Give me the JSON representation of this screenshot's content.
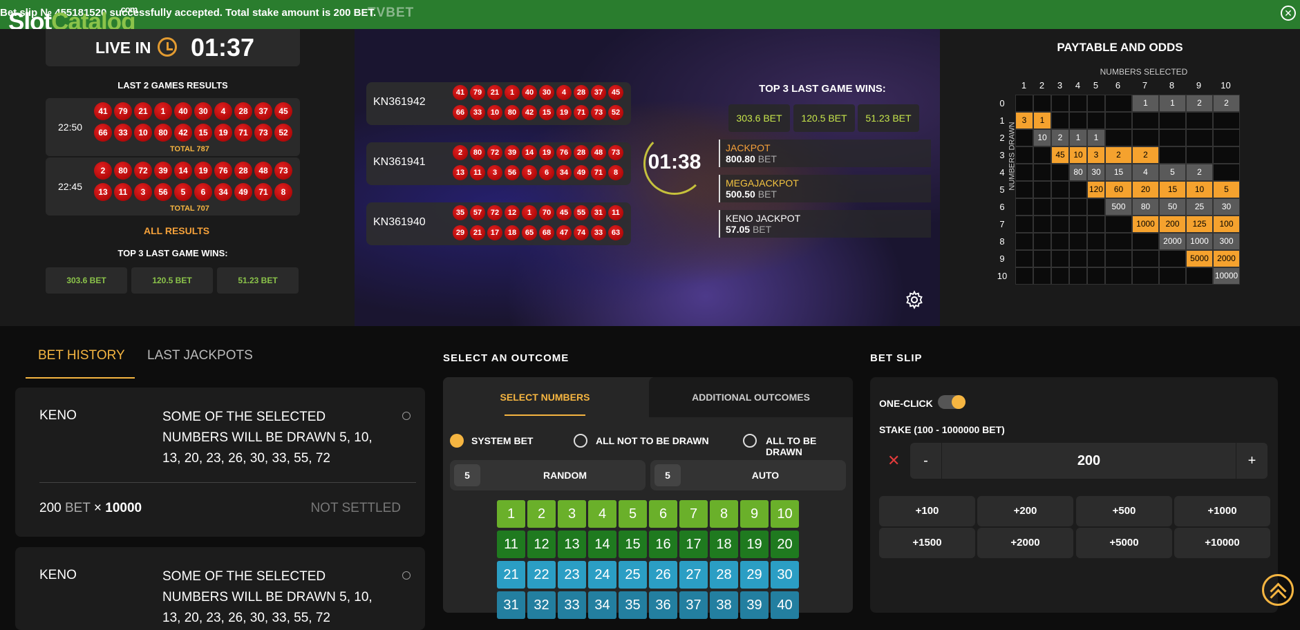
{
  "notification": {
    "message": "Bet slip № 455181520 successfully accepted. Total stake amount is 200 BET.",
    "brand": "TVBET",
    "close_icon": "close-icon"
  },
  "logo": {
    "part1": "Slot",
    "part2": "Catalog",
    "domain": ".com"
  },
  "live": {
    "label": "LIVE IN",
    "time": "01:37"
  },
  "last_games": {
    "title": "LAST 2 GAMES RESULTS",
    "games": [
      {
        "time": "22:50",
        "row1": [
          "41",
          "79",
          "21",
          "1",
          "40",
          "30",
          "4",
          "28",
          "37",
          "45"
        ],
        "row2": [
          "66",
          "33",
          "10",
          "80",
          "42",
          "15",
          "19",
          "71",
          "73",
          "52"
        ],
        "total": "TOTAL 787"
      },
      {
        "time": "22:45",
        "row1": [
          "2",
          "80",
          "72",
          "39",
          "14",
          "19",
          "76",
          "28",
          "48",
          "73"
        ],
        "row2": [
          "13",
          "11",
          "3",
          "56",
          "5",
          "6",
          "34",
          "49",
          "71",
          "8"
        ],
        "total": "TOTAL 707"
      }
    ],
    "all_results": "ALL RESULTS",
    "top3_title": "TOP 3 LAST GAME WINS:",
    "top3": [
      "303.6 BET",
      "120.5 BET",
      "51.23 BET"
    ]
  },
  "video": {
    "rows": [
      {
        "code": "KN361942",
        "row1": [
          "41",
          "79",
          "21",
          "1",
          "40",
          "30",
          "4",
          "28",
          "37",
          "45"
        ],
        "row2": [
          "66",
          "33",
          "10",
          "80",
          "42",
          "15",
          "19",
          "71",
          "73",
          "52"
        ]
      },
      {
        "code": "KN361941",
        "row1": [
          "2",
          "80",
          "72",
          "39",
          "14",
          "19",
          "76",
          "28",
          "48",
          "73"
        ],
        "row2": [
          "13",
          "11",
          "3",
          "56",
          "5",
          "6",
          "34",
          "49",
          "71",
          "8"
        ]
      },
      {
        "code": "KN361940",
        "row1": [
          "35",
          "57",
          "72",
          "12",
          "1",
          "70",
          "45",
          "55",
          "31",
          "11"
        ],
        "row2": [
          "29",
          "21",
          "17",
          "18",
          "65",
          "68",
          "47",
          "74",
          "33",
          "63"
        ]
      }
    ],
    "timer": "01:38",
    "top3_title": "TOP 3 LAST GAME WINS:",
    "top3": [
      "303.6 BET",
      "120.5 BET",
      "51.23 BET"
    ],
    "jackpots": [
      {
        "name": "JACKPOT",
        "value": "800.80",
        "unit": "BET",
        "color": "#f5a13a"
      },
      {
        "name": "MEGAJACKPOT",
        "value": "500.50",
        "unit": "BET",
        "color": "#f5c541"
      },
      {
        "name": "KENO JACKPOT",
        "value": "57.05",
        "unit": "BET",
        "color": "#ffffff"
      }
    ],
    "settings_icon": "gear-icon"
  },
  "paytable": {
    "title": "PAYTABLE AND ODDS",
    "numbers_selected": "NUMBERS SELECTED",
    "numbers_drawn": "NUMBERS DRAWN",
    "cols": [
      "1",
      "2",
      "3",
      "4",
      "5",
      "6",
      "7",
      "8",
      "9",
      "10"
    ],
    "rows": [
      "0",
      "1",
      "2",
      "3",
      "4",
      "5",
      "6",
      "7",
      "8",
      "9",
      "10"
    ],
    "cells": [
      [
        "",
        "",
        "",
        "",
        "",
        "",
        "1",
        "1",
        "2",
        "2"
      ],
      [
        "3",
        "1",
        "",
        "",
        "",
        "",
        "",
        "",
        "",
        ""
      ],
      [
        "",
        "10",
        "2",
        "1",
        "1",
        "",
        "",
        "",
        "",
        ""
      ],
      [
        "",
        "",
        "45",
        "10",
        "3",
        "2",
        "2",
        "",
        "",
        ""
      ],
      [
        "",
        "",
        "",
        "80",
        "30",
        "15",
        "4",
        "5",
        "2",
        ""
      ],
      [
        "",
        "",
        "",
        "",
        "120",
        "60",
        "20",
        "15",
        "10",
        "5"
      ],
      [
        "",
        "",
        "",
        "",
        "",
        "500",
        "80",
        "50",
        "25",
        "30"
      ],
      [
        "",
        "",
        "",
        "",
        "",
        "",
        "1000",
        "200",
        "125",
        "100"
      ],
      [
        "",
        "",
        "",
        "",
        "",
        "",
        "",
        "2000",
        "1000",
        "300"
      ],
      [
        "",
        "",
        "",
        "",
        "",
        "",
        "",
        "",
        "5000",
        "2000"
      ],
      [
        "",
        "",
        "",
        "",
        "",
        "",
        "",
        "",
        "",
        "10000"
      ]
    ],
    "styles": [
      [
        "",
        "",
        "",
        "",
        "",
        "",
        "g",
        "g",
        "g",
        "g"
      ],
      [
        "o",
        "o",
        "",
        "",
        "",
        "",
        "",
        "",
        "",
        ""
      ],
      [
        "",
        "g",
        "g",
        "g",
        "g",
        "",
        "",
        "",
        "",
        ""
      ],
      [
        "",
        "",
        "o",
        "o",
        "o",
        "o",
        "o",
        "",
        "",
        ""
      ],
      [
        "",
        "",
        "",
        "g",
        "g",
        "g",
        "g",
        "g",
        "g",
        ""
      ],
      [
        "",
        "",
        "",
        "",
        "o",
        "o",
        "o",
        "o",
        "o",
        "o"
      ],
      [
        "",
        "",
        "",
        "",
        "",
        "g",
        "g",
        "g",
        "g",
        "g"
      ],
      [
        "",
        "",
        "",
        "",
        "",
        "",
        "o",
        "o",
        "o",
        "o"
      ],
      [
        "",
        "",
        "",
        "",
        "",
        "",
        "",
        "g",
        "g",
        "g"
      ],
      [
        "",
        "",
        "",
        "",
        "",
        "",
        "",
        "",
        "o",
        "o"
      ],
      [
        "",
        "",
        "",
        "",
        "",
        "",
        "",
        "",
        "",
        "g"
      ]
    ]
  },
  "history": {
    "tab_active": "BET HISTORY",
    "tab_other": "LAST JACKPOTS",
    "cards": [
      {
        "game": "KENO",
        "desc": "SOME OF THE SELECTED NUMBERS WILL BE DRAWN 5, 10, 13, 20, 23, 26, 30, 33, 55, 72",
        "stake": "200",
        "unit": "BET",
        "times": "×",
        "odds": "10000",
        "status": "NOT SETTLED"
      },
      {
        "game": "KENO",
        "desc": "SOME OF THE SELECTED NUMBERS WILL BE DRAWN 5, 10, 13, 20, 23, 26, 30, 33, 55, 72"
      }
    ]
  },
  "outcome": {
    "title": "SELECT AN OUTCOME",
    "tab_active": "SELECT NUMBERS",
    "tab_other": "ADDITIONAL OUTCOMES",
    "radios": [
      "SYSTEM BET",
      "ALL NOT TO BE DRAWN",
      "ALL TO BE DRAWN"
    ],
    "random": {
      "count": "5",
      "label": "RANDOM"
    },
    "auto": {
      "count": "5",
      "label": "AUTO"
    },
    "numbers": [
      [
        "1",
        "2",
        "3",
        "4",
        "5",
        "6",
        "7",
        "8",
        "9",
        "10"
      ],
      [
        "11",
        "12",
        "13",
        "14",
        "15",
        "16",
        "17",
        "18",
        "19",
        "20"
      ],
      [
        "21",
        "22",
        "23",
        "24",
        "25",
        "26",
        "27",
        "28",
        "29",
        "30"
      ],
      [
        "31",
        "32",
        "33",
        "34",
        "35",
        "36",
        "37",
        "38",
        "39",
        "40"
      ]
    ]
  },
  "betslip": {
    "title": "BET SLIP",
    "one_click": "ONE-CLICK",
    "stake_label": "STAKE (100 - 1000000 BET)",
    "minus": "-",
    "stake": "200",
    "plus": "+",
    "clear": "✕",
    "quick": [
      "+100",
      "+200",
      "+500",
      "+1000",
      "+1500",
      "+2000",
      "+5000",
      "+10000"
    ]
  }
}
